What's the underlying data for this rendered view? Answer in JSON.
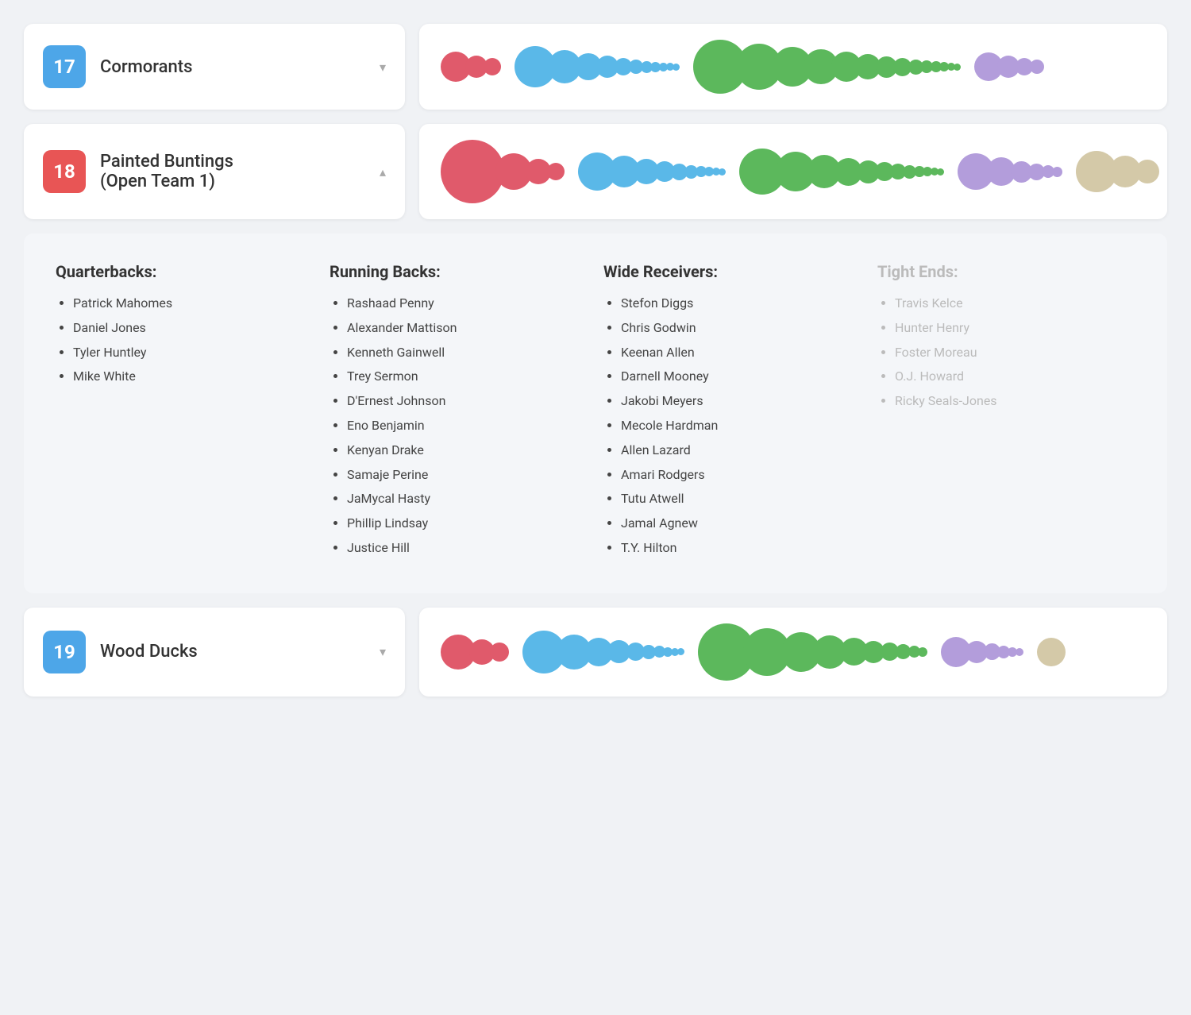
{
  "teams": [
    {
      "id": 17,
      "name": "Cormorants",
      "numberColor": "blue",
      "expanded": false,
      "chevron": "▾",
      "bubbleGroups": [
        {
          "color": "#e05a6b",
          "sizes": [
            38,
            28,
            22
          ]
        },
        {
          "color": "#5ab8e8",
          "sizes": [
            52,
            42,
            34,
            28,
            22,
            18,
            15,
            13,
            11,
            10,
            9
          ]
        },
        {
          "color": "#5cb85c",
          "sizes": [
            68,
            58,
            50,
            44,
            38,
            32,
            27,
            23,
            19,
            16,
            14,
            12,
            10,
            9
          ]
        },
        {
          "color": "#b39ddb",
          "sizes": [
            36,
            28,
            22,
            18
          ]
        }
      ]
    }
  ],
  "expanded_team": {
    "id": 18,
    "name": "Painted Buntings\n(Open Team 1)",
    "numberColor": "red",
    "expanded": true,
    "chevron": "▴",
    "bubbleGroups": [
      {
        "color": "#e05a6b",
        "sizes": [
          80,
          46,
          32,
          22
        ]
      },
      {
        "color": "#5ab8e8",
        "sizes": [
          48,
          40,
          32,
          26,
          21,
          17,
          14,
          12,
          10,
          9
        ]
      },
      {
        "color": "#5cb85c",
        "sizes": [
          58,
          50,
          42,
          35,
          29,
          24,
          20,
          17,
          14,
          12,
          10,
          9
        ]
      },
      {
        "color": "#b39ddb",
        "sizes": [
          46,
          36,
          27,
          21,
          16,
          13
        ]
      },
      {
        "color": "#d4c9a8",
        "sizes": [
          52,
          40,
          30
        ]
      }
    ],
    "positions": [
      {
        "title": "Quarterbacks:",
        "faded": false,
        "players": [
          {
            "name": "Patrick Mahomes",
            "faded": false
          },
          {
            "name": "Daniel Jones",
            "faded": false
          },
          {
            "name": "Tyler Huntley",
            "faded": false
          },
          {
            "name": "Mike White",
            "faded": false
          }
        ]
      },
      {
        "title": "Running Backs:",
        "faded": false,
        "players": [
          {
            "name": "Rashaad Penny",
            "faded": false
          },
          {
            "name": "Alexander Mattison",
            "faded": false
          },
          {
            "name": "Kenneth Gainwell",
            "faded": false
          },
          {
            "name": "Trey Sermon",
            "faded": false
          },
          {
            "name": "D'Ernest Johnson",
            "faded": false
          },
          {
            "name": "Eno Benjamin",
            "faded": false
          },
          {
            "name": "Kenyan Drake",
            "faded": false
          },
          {
            "name": "Samaje Perine",
            "faded": false
          },
          {
            "name": "JaMycal Hasty",
            "faded": false
          },
          {
            "name": "Phillip Lindsay",
            "faded": false
          },
          {
            "name": "Justice Hill",
            "faded": false
          }
        ]
      },
      {
        "title": "Wide Receivers:",
        "faded": false,
        "players": [
          {
            "name": "Stefon Diggs",
            "faded": false
          },
          {
            "name": "Chris Godwin",
            "faded": false
          },
          {
            "name": "Keenan Allen",
            "faded": false
          },
          {
            "name": "Darnell Mooney",
            "faded": false
          },
          {
            "name": "Jakobi Meyers",
            "faded": false
          },
          {
            "name": "Mecole Hardman",
            "faded": false
          },
          {
            "name": "Allen Lazard",
            "faded": false
          },
          {
            "name": "Amari Rodgers",
            "faded": false
          },
          {
            "name": "Tutu Atwell",
            "faded": false
          },
          {
            "name": "Jamal Agnew",
            "faded": false
          },
          {
            "name": "T.Y. Hilton",
            "faded": false
          }
        ]
      },
      {
        "title": "Tight Ends:",
        "faded": true,
        "players": [
          {
            "name": "Travis Kelce",
            "faded": true
          },
          {
            "name": "Hunter Henry",
            "faded": true
          },
          {
            "name": "Foster Moreau",
            "faded": true
          },
          {
            "name": "O.J. Howard",
            "faded": true
          },
          {
            "name": "Ricky Seals-Jones",
            "faded": true
          }
        ]
      }
    ]
  },
  "team_19": {
    "id": 19,
    "name": "Wood Ducks",
    "numberColor": "blue",
    "expanded": false,
    "chevron": "▾",
    "bubbleGroups": [
      {
        "color": "#e05a6b",
        "sizes": [
          44,
          32,
          24
        ]
      },
      {
        "color": "#5ab8e8",
        "sizes": [
          54,
          44,
          36,
          29,
          23,
          18,
          15,
          12,
          10,
          9
        ]
      },
      {
        "color": "#5cb85c",
        "sizes": [
          72,
          60,
          50,
          42,
          35,
          28,
          23,
          19,
          15,
          12
        ]
      },
      {
        "color": "#b39ddb",
        "sizes": [
          38,
          28,
          21,
          16,
          12,
          10
        ]
      },
      {
        "color": "#d4c9a8",
        "sizes": [
          36
        ]
      }
    ]
  }
}
